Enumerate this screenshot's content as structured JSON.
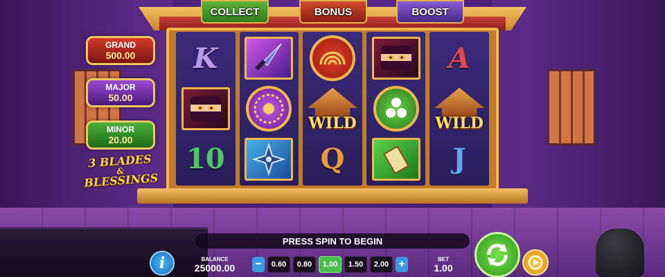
{
  "top_tabs": {
    "collect": "COLLECT",
    "bonus": "BONUS",
    "boost": "BOOST"
  },
  "jackpots": [
    {
      "label": "GRAND",
      "value": "500.00",
      "color": "#b82a1e"
    },
    {
      "label": "MAJOR",
      "value": "50.00",
      "color": "#7a3ab8"
    },
    {
      "label": "MINOR",
      "value": "20.00",
      "color": "#3a9a2a"
    }
  ],
  "logo": {
    "line1": "3 BLADES",
    "line2": "&",
    "line3": "BLESSINGS"
  },
  "reels": [
    [
      "K",
      "ninja-portrait",
      "10"
    ],
    [
      "kunai",
      "purple-medallion",
      "shuriken"
    ],
    [
      "red-medallion",
      "WILD",
      "Q"
    ],
    [
      "ninja-portrait",
      "green-medallion",
      "scroll"
    ],
    [
      "A",
      "WILD",
      "J"
    ]
  ],
  "message": "PRESS SPIN TO BEGIN",
  "balance": {
    "label": "BALANCE",
    "value": "25000.00"
  },
  "bet": {
    "label": "BET",
    "value": "1.00"
  },
  "bet_options": [
    "0.60",
    "0.80",
    "1.00",
    "1.50",
    "2.00"
  ],
  "selected_bet": "1.00",
  "buttons": {
    "info": "i",
    "minus": "−",
    "plus": "+"
  },
  "icons": {
    "spin": "refresh-arrows-icon",
    "autoplay": "autoplay-icon"
  }
}
